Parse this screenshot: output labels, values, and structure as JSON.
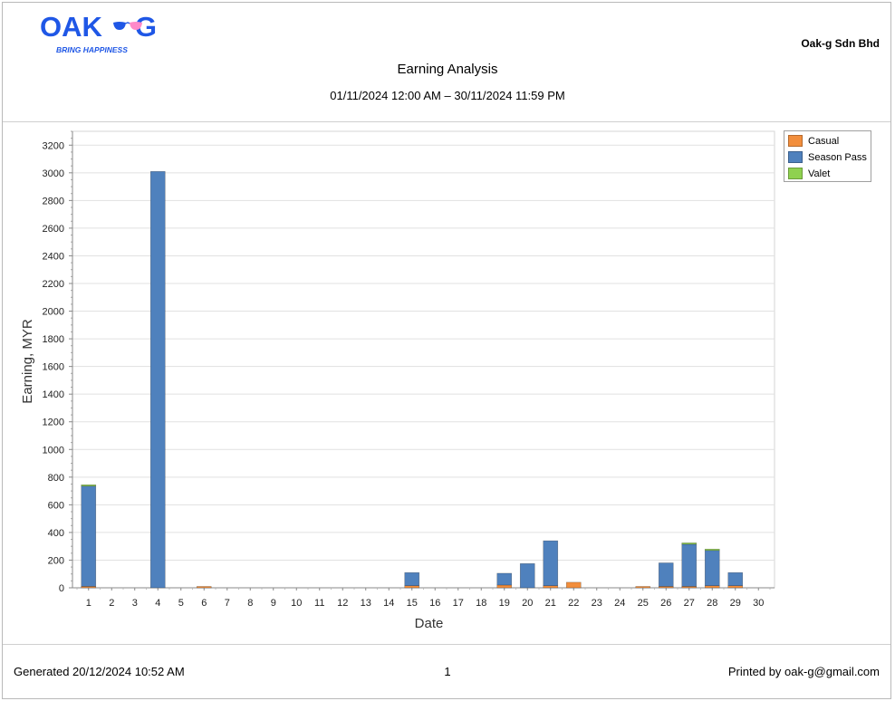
{
  "header": {
    "logo_text": "OAK-G",
    "logo_tagline": "BRING HAPPINESS",
    "company": "Oak-g Sdn Bhd",
    "title": "Earning Analysis",
    "subtitle": "01/11/2024 12:00 AM – 30/11/2024 11:59 PM"
  },
  "footer": {
    "generated": "Generated 20/12/2024 10:52 AM",
    "page_number": "1",
    "printed_by": "Printed by oak-g@gmail.com"
  },
  "colors": {
    "casual": "#f28e3c",
    "season_pass": "#4f81bd",
    "valet": "#8fd14f",
    "logo": "#1f57e6"
  },
  "chart_data": {
    "type": "bar",
    "stacked": true,
    "xlabel": "Date",
    "ylabel": "Earning, MYR",
    "ylim": [
      0,
      3300
    ],
    "yticks": [
      0,
      200,
      400,
      600,
      800,
      1000,
      1200,
      1400,
      1600,
      1800,
      2000,
      2200,
      2400,
      2600,
      2800,
      3000,
      3200
    ],
    "grid": true,
    "legend_position": "top-right",
    "categories": [
      "1",
      "2",
      "3",
      "4",
      "5",
      "6",
      "7",
      "8",
      "9",
      "10",
      "11",
      "12",
      "13",
      "14",
      "15",
      "16",
      "17",
      "18",
      "19",
      "20",
      "21",
      "22",
      "23",
      "24",
      "25",
      "26",
      "27",
      "28",
      "29",
      "30"
    ],
    "series": [
      {
        "name": "Casual",
        "color": "#f28e3c",
        "values": [
          10,
          0,
          0,
          0,
          0,
          8,
          0,
          0,
          0,
          0,
          0,
          0,
          0,
          0,
          15,
          0,
          0,
          0,
          20,
          0,
          15,
          40,
          0,
          0,
          8,
          10,
          10,
          15,
          15,
          0
        ]
      },
      {
        "name": "Season Pass",
        "color": "#4f81bd",
        "values": [
          725,
          0,
          0,
          3010,
          0,
          0,
          0,
          0,
          0,
          0,
          0,
          0,
          0,
          0,
          95,
          0,
          0,
          0,
          85,
          175,
          325,
          0,
          0,
          0,
          0,
          170,
          305,
          255,
          95,
          0
        ]
      },
      {
        "name": "Valet",
        "color": "#8fd14f",
        "values": [
          5,
          0,
          0,
          0,
          0,
          0,
          0,
          0,
          0,
          0,
          0,
          0,
          0,
          0,
          0,
          0,
          0,
          0,
          0,
          0,
          0,
          0,
          0,
          0,
          0,
          0,
          5,
          3,
          0,
          0
        ]
      }
    ]
  }
}
